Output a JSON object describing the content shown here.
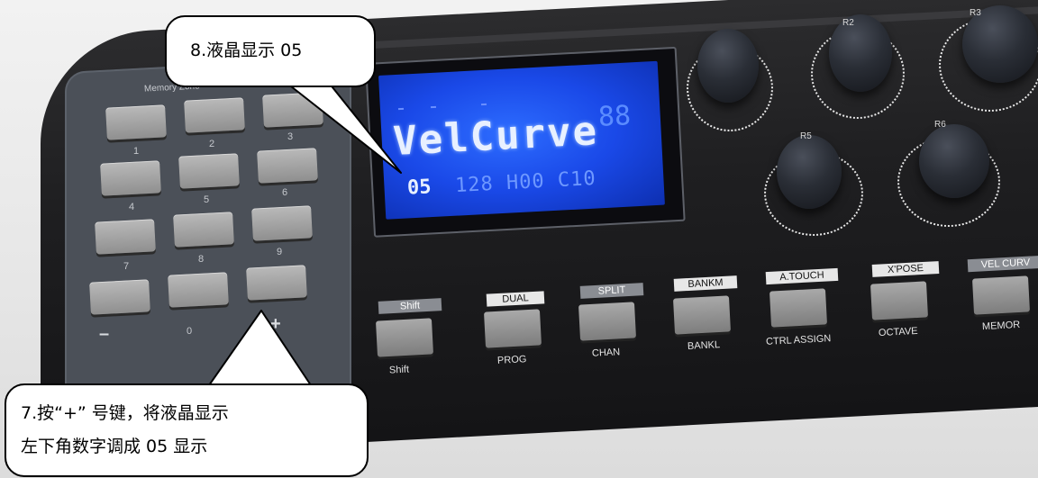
{
  "photo": {
    "memory_zone_label": "Memory Zone",
    "pad_numbers": [
      "1",
      "2",
      "3",
      "4",
      "5",
      "6",
      "7",
      "8",
      "9",
      "0"
    ],
    "pad_symbols": [
      "–",
      "+"
    ],
    "lcd": {
      "main_text": "VelCurve",
      "big_digits": "88",
      "value": "05",
      "segments": "128 H00 C10"
    },
    "knob_labels": [
      "R2",
      "R3",
      "R5",
      "R6"
    ],
    "function_buttons": [
      {
        "top": "Shift",
        "bottom": "Shift"
      },
      {
        "top": "DUAL",
        "bottom": "PROG"
      },
      {
        "top": "SPLIT",
        "bottom": "CHAN"
      },
      {
        "top": "BANKM",
        "bottom": "BANKL"
      },
      {
        "top": "A.TOUCH",
        "bottom": "CTRL ASSIGN"
      },
      {
        "top": "X'POSE",
        "bottom": "OCTAVE"
      },
      {
        "top": "VEL CURV",
        "bottom": "MEMOR"
      }
    ]
  },
  "callouts": {
    "top": "8.液晶显示 05",
    "bottom_line1": "7.按“+” 号键，将液晶显示",
    "bottom_line2": "左下角数字调成 05 显示"
  }
}
